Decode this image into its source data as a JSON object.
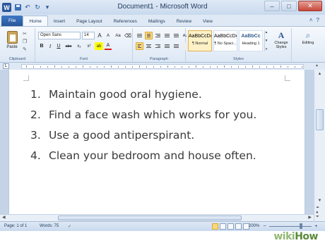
{
  "window": {
    "title": "Document1 - Microsoft Word",
    "controls": {
      "minimize": "–",
      "maximize": "□",
      "close": "✕"
    }
  },
  "qat": {
    "word_logo": "W",
    "undo": "↶",
    "redo": "↻",
    "customize": "▾"
  },
  "tabs": [
    {
      "label": "File"
    },
    {
      "label": "Home"
    },
    {
      "label": "Insert"
    },
    {
      "label": "Page Layout"
    },
    {
      "label": "References"
    },
    {
      "label": "Mailings"
    },
    {
      "label": "Review"
    },
    {
      "label": "View"
    }
  ],
  "ribbon": {
    "clipboard": {
      "paste_label": "Paste",
      "group_label": "Clipboard",
      "cut": "✂",
      "copy": "❐",
      "format_painter": "✎"
    },
    "font": {
      "group_label": "Font",
      "font_name": "Open Sans",
      "font_size": "14",
      "bold": "B",
      "italic": "I",
      "underline": "U",
      "strikethrough": "abc",
      "subscript": "x₂",
      "superscript": "x²",
      "grow": "A",
      "shrink": "A",
      "case": "Aa",
      "clear": "⌫",
      "highlight": "ab",
      "font_color": "A"
    },
    "paragraph": {
      "group_label": "Paragraph",
      "sort": "A↓",
      "pilcrow": "¶"
    },
    "styles": {
      "group_label": "Styles",
      "items": [
        {
          "preview": "AaBbCcDc",
          "name": "¶ Normal"
        },
        {
          "preview": "AaBbCcDc",
          "name": "¶ No Spaci..."
        },
        {
          "preview": "AaBbCc",
          "name": "Heading 1"
        }
      ],
      "change_styles": "Change Styles",
      "change_styles_glyph": "A"
    },
    "editing": {
      "label": "Editing",
      "glyph": "⌕"
    }
  },
  "ruler": {
    "tab_selector": "L",
    "toggle": "▾"
  },
  "document": {
    "items": [
      {
        "num": "1.",
        "text": "Maintain good oral hygiene."
      },
      {
        "num": "2.",
        "text": "Find a face wash which works for you."
      },
      {
        "num": "3.",
        "text": "Use a good antiperspirant."
      },
      {
        "num": "4.",
        "text": "Clean your bedroom and house often."
      }
    ]
  },
  "status": {
    "page": "Page: 1 of 1",
    "words": "Words: 75",
    "proofing": "✓",
    "zoom": "200%",
    "zoom_fraction": 0.75,
    "zoom_minus": "−",
    "zoom_plus": "+"
  },
  "watermark": {
    "wiki": "wiki",
    "how": "How"
  }
}
